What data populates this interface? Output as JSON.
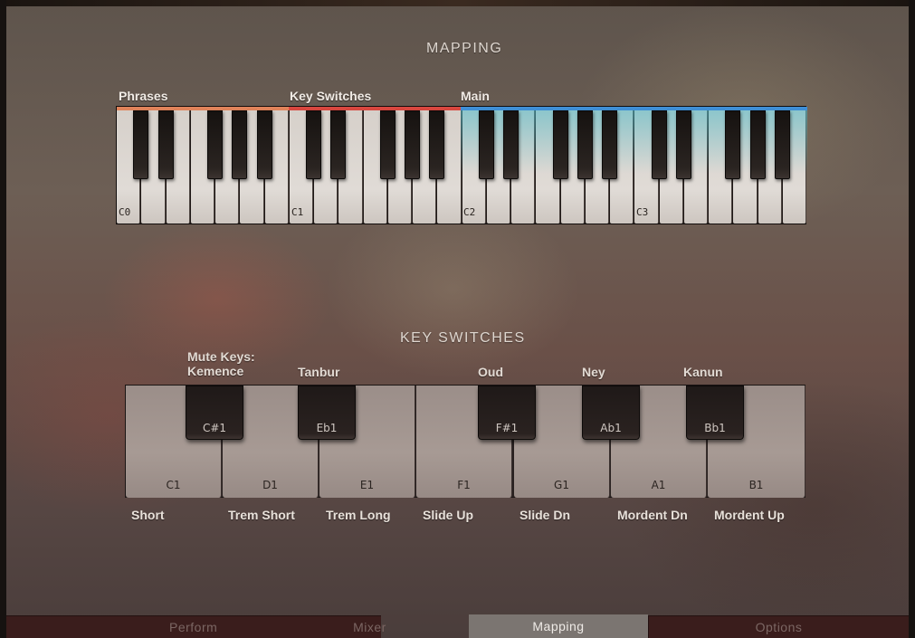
{
  "mapping": {
    "title": "MAPPING",
    "zones": {
      "phrases": "Phrases",
      "key_switches": "Key Switches",
      "main": "Main"
    },
    "zone_colors": {
      "phrases": "#e0835a",
      "key_switches": "#d9473f",
      "main": "#3f8fd6"
    },
    "octave_labels": [
      "C0",
      "C1",
      "C2",
      "C3"
    ]
  },
  "key_switches": {
    "title": "KEY SWITCHES",
    "white_keys": [
      {
        "note": "C1",
        "articulation": "Short"
      },
      {
        "note": "D1",
        "articulation": "Trem Short"
      },
      {
        "note": "E1",
        "articulation": "Trem Long"
      },
      {
        "note": "F1",
        "articulation": "Slide Up"
      },
      {
        "note": "G1",
        "articulation": "Slide Dn"
      },
      {
        "note": "A1",
        "articulation": "Mordent Dn"
      },
      {
        "note": "B1",
        "articulation": "Mordent Up"
      }
    ],
    "black_keys": [
      {
        "note": "C#1",
        "label": "Mute Keys:\nKemence"
      },
      {
        "note": "Eb1",
        "label": "Tanbur"
      },
      {
        "note": "F#1",
        "label": "Oud"
      },
      {
        "note": "Ab1",
        "label": "Ney"
      },
      {
        "note": "Bb1",
        "label": "Kanun"
      }
    ]
  },
  "tabs": [
    {
      "label": "Perform",
      "active": false
    },
    {
      "label": "Mixer",
      "active": false
    },
    {
      "label": "Mapping",
      "active": true
    },
    {
      "label": "Options",
      "active": false
    }
  ]
}
